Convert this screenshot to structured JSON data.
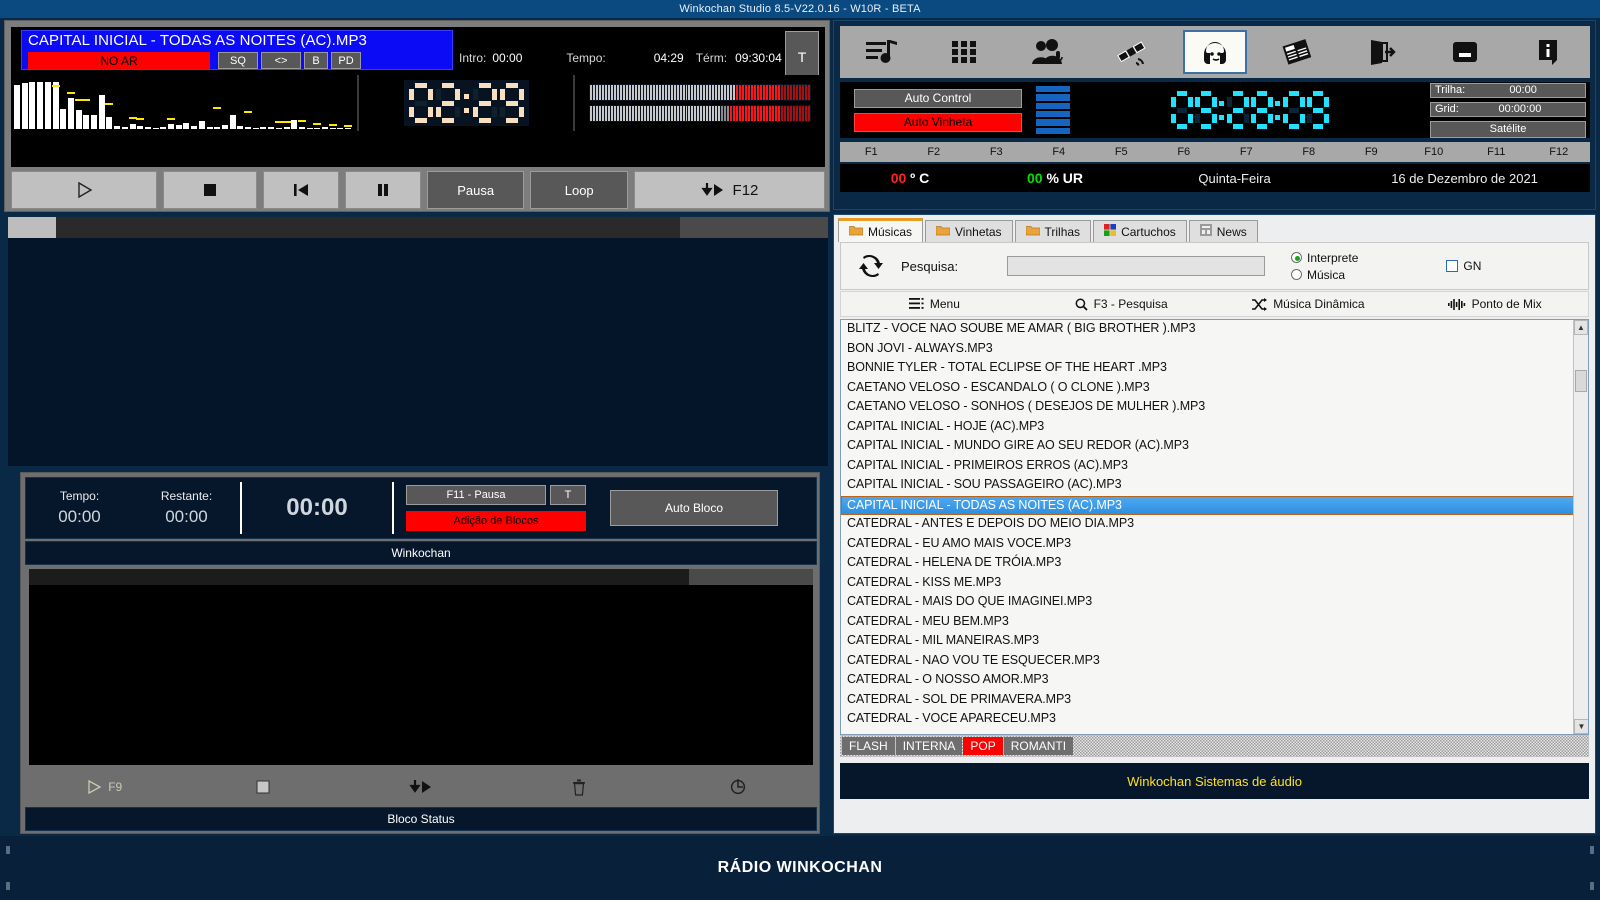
{
  "window": {
    "title": "Winkochan Studio 8.5-V22.0.16 - W10R - BETA"
  },
  "player": {
    "track_title": "CAPITAL INICIAL - TODAS AS NOITES (AC).MP3",
    "on_air_label": "NO AR",
    "flag_buttons": [
      "SQ",
      "<>",
      "B",
      "PD"
    ],
    "t_button": "T",
    "intro_label": "Intro:",
    "intro_value": "00:00",
    "tempo_label": "Tempo:",
    "tempo_value": "04:29",
    "term_label": "Térm:",
    "term_value": "09:30:04",
    "elapsed_display": "02:29",
    "transport": {
      "play": "play-icon",
      "stop": "stop-icon",
      "previous": "previous-icon",
      "pause": "pause-icon",
      "pausa_label": "Pausa",
      "loop_label": "Loop",
      "f12_label": "F12"
    }
  },
  "block": {
    "tempo_label": "Tempo:",
    "tempo_value": "00:00",
    "restante_label": "Restante:",
    "restante_value": "00:00",
    "big_time": "00:00",
    "f11_label": "F11 - Pausa",
    "t_label": "T",
    "adicao_label": "Adição de Blocos",
    "auto_bloco_label": "Auto Bloco",
    "name": "Winkochan",
    "tools": [
      "F9",
      "",
      "",
      "",
      ""
    ],
    "f9_label": "F9",
    "status_label": "Bloco Status"
  },
  "toolbar": {
    "icons": [
      {
        "name": "playlist-music-icon",
        "label": "Playlist"
      },
      {
        "name": "grid-icon",
        "label": "Grade"
      },
      {
        "name": "speakers-mic-icon",
        "label": "Locutores"
      },
      {
        "name": "satellite-icon",
        "label": "Satélite"
      },
      {
        "name": "headphones-icon",
        "label": "Estúdio",
        "active": true
      },
      {
        "name": "news-icon",
        "label": "News"
      },
      {
        "name": "exit-icon",
        "label": "Sair"
      },
      {
        "name": "minimize-icon",
        "label": "Minimizar"
      },
      {
        "name": "info-icon",
        "label": "Informações"
      }
    ]
  },
  "status": {
    "auto_control_label": "Auto Control",
    "auto_vinheta_label": "Auto Vinheta",
    "clock": "09:28:09",
    "trilha_label": "Trilha:",
    "trilha_value": "00:00",
    "grid_label": "Grid:",
    "grid_value": "00:00:00",
    "satelite_label": "Satélite",
    "fkeys": [
      "F1",
      "F2",
      "F3",
      "F4",
      "F5",
      "F6",
      "F7",
      "F8",
      "F9",
      "F10",
      "F11",
      "F12"
    ],
    "temp_value": "00",
    "temp_unit": "º C",
    "humidity_value": "00",
    "humidity_unit": "% UR",
    "day_of_week": "Quinta-Feira",
    "date": "16 de Dezembro de 2021"
  },
  "library": {
    "tabs": [
      {
        "label": "Músicas",
        "icon": "folder-icon",
        "active": true
      },
      {
        "label": "Vinhetas",
        "icon": "folder-icon"
      },
      {
        "label": "Trilhas",
        "icon": "folder-icon"
      },
      {
        "label": "Cartuchos",
        "icon": "cartridge-icon"
      },
      {
        "label": "News",
        "icon": "news-small-icon"
      }
    ],
    "refresh_icon": "refresh-icon",
    "search_label": "Pesquisa:",
    "search_value": "",
    "search_placeholder": "",
    "radio_interprete": "Interprete",
    "radio_musica": "Música",
    "gn_label": "GN",
    "menu_items": [
      {
        "label": "Menu",
        "icon": "hamburger-icon"
      },
      {
        "label": "F3 -  Pesquisa",
        "icon": "search-icon"
      },
      {
        "label": "Música Dinâmica",
        "icon": "shuffle-icon"
      },
      {
        "label": "Ponto de Mix",
        "icon": "waveform-icon"
      }
    ],
    "items": [
      "BLITZ - VOCE NAO SOUBE ME AMAR ( BIG BROTHER ).MP3",
      "BON JOVI  - ALWAYS.MP3",
      "BONNIE TYLER - TOTAL ECLIPSE OF THE HEART  .MP3",
      "CAETANO VELOSO - ESCANDALO ( O CLONE ).MP3",
      "CAETANO VELOSO - SONHOS ( DESEJOS DE MULHER ).MP3",
      "CAPITAL INICIAL - HOJE (AC).MP3",
      "CAPITAL INICIAL - MUNDO GIRE AO SEU REDOR (AC).MP3",
      "CAPITAL INICIAL - PRIMEIROS ERROS (AC).MP3",
      "CAPITAL INICIAL - SOU PASSAGEIRO (AC).MP3",
      "CAPITAL INICIAL - TODAS AS NOITES (AC).MP3",
      "CATEDRAL - ANTES E DEPOIS DO MEIO DIA.MP3",
      "CATEDRAL - EU AMO MAIS VOCE.MP3",
      "CATEDRAL - HELENA DE TRÓIA.MP3",
      "CATEDRAL - KISS ME.MP3",
      "CATEDRAL - MAIS DO QUE IMAGINEI.MP3",
      "CATEDRAL - MEU BEM.MP3",
      "CATEDRAL - MIL MANEIRAS.MP3",
      "CATEDRAL - NAO VOU TE ESQUECER.MP3",
      "CATEDRAL - O NOSSO AMOR.MP3",
      "CATEDRAL - SOL DE PRIMAVERA.MP3",
      "CATEDRAL - VOCE APARECEU.MP3"
    ],
    "selected_index": 9,
    "categories": [
      {
        "label": "FLASH"
      },
      {
        "label": "INTERNA"
      },
      {
        "label": "POP",
        "highlighted": true
      },
      {
        "label": "ROMANTI"
      }
    ],
    "footer": "Winkochan Sistemas de áudio"
  },
  "footer": {
    "station": "RÁDIO WINKOCHAN"
  },
  "colors": {
    "accent_blue": "#0b4a80",
    "on_air_red": "#ff0000",
    "clock_cyan": "#23e0ff",
    "selection_blue": "#2e8fe0",
    "yellow_text": "#ffe11a"
  }
}
